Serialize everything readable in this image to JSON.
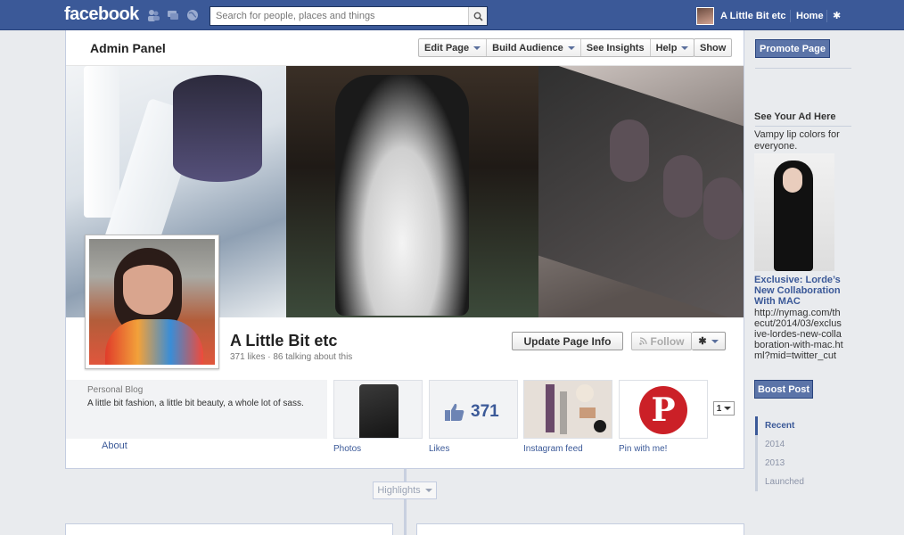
{
  "topbar": {
    "logo": "facebook",
    "search_placeholder": "Search for people, places and things",
    "user_name": "A Little Bit etc",
    "home_label": "Home"
  },
  "admin": {
    "title": "Admin Panel",
    "buttons": {
      "edit_page": "Edit Page",
      "build_audience": "Build Audience",
      "see_insights": "See Insights",
      "help": "Help",
      "show": "Show"
    }
  },
  "page": {
    "name": "A Little Bit etc",
    "stats": "371 likes · 86 talking about this",
    "update_button": "Update Page Info",
    "follow_button": "Follow",
    "gear_symbol": "✱",
    "category": "Personal Blog",
    "description": "A little bit fashion, a little bit beauty, a whole lot of sass.",
    "about_label": "About"
  },
  "apps": [
    {
      "label": "Photos"
    },
    {
      "label": "Likes",
      "count": "371"
    },
    {
      "label": "Instagram feed"
    },
    {
      "label": "Pin with me!"
    }
  ],
  "pager_value": "1",
  "timeline": {
    "highlights_label": "Highlights"
  },
  "right_column": {
    "promote_label": "Promote Page",
    "ad_heading": "See Your Ad Here",
    "ad_text": "Vampy lip colors for everyone.",
    "ad_title": "Exclusive: Lorde’s New Collaboration With MAC",
    "ad_url": "http://nymag.com/thecut/2014/03/exclusive-lordes-new-collaboration-with-mac.html?mid=twitter_cut",
    "boost_label": "Boost Post",
    "years": [
      "Recent",
      "2014",
      "2013",
      "Launched"
    ]
  },
  "colors": {
    "brand_blue": "#3b5998",
    "topbar": "#3b5998",
    "pinterest_red": "#cb2027"
  },
  "icons": [
    "friend-requests-icon",
    "messages-icon",
    "notifications-globe-icon",
    "search-icon",
    "gear-icon",
    "rss-icon",
    "thumbs-up-icon",
    "pinterest-icon",
    "caret-down-icon"
  ]
}
